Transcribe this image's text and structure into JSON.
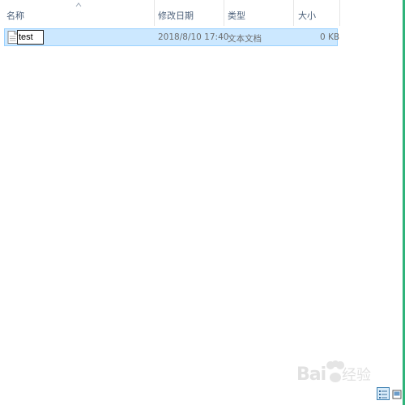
{
  "columns": {
    "name": "名称",
    "date_modified": "修改日期",
    "type": "类型",
    "size": "大小"
  },
  "files": [
    {
      "name": "test",
      "date_modified": "2018/8/10 17:40",
      "type": "文本文档",
      "size": "0 KB",
      "icon": "text-file-icon",
      "state": "selected, renaming"
    }
  ],
  "view_buttons": [
    "details-view-icon",
    "large-icons-view-icon"
  ],
  "watermark": "Baidu 经验",
  "colors": {
    "selection_fill": "#cce8ff",
    "selection_border": "#99d1ff",
    "header_text": "#4c607a",
    "window_edge": "#2fb37a"
  }
}
